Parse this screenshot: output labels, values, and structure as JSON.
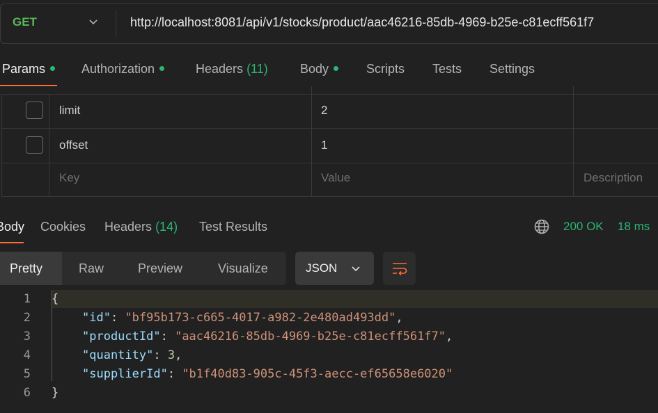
{
  "request": {
    "method": "GET",
    "url": "http://localhost:8081/api/v1/stocks/product/aac46216-85db-4969-b25e-c81ecff561f7"
  },
  "request_tabs": [
    {
      "label": "Params",
      "dot": true,
      "count": ""
    },
    {
      "label": "Authorization",
      "dot": true,
      "count": ""
    },
    {
      "label": "Headers",
      "dot": false,
      "count": "(11)"
    },
    {
      "label": "Body",
      "dot": true,
      "count": ""
    },
    {
      "label": "Scripts",
      "dot": false,
      "count": ""
    },
    {
      "label": "Tests",
      "dot": false,
      "count": ""
    },
    {
      "label": "Settings",
      "dot": false,
      "count": ""
    }
  ],
  "params": {
    "rows": [
      {
        "key": "limit",
        "value": "2",
        "checked": false
      },
      {
        "key": "offset",
        "value": "1",
        "checked": false
      }
    ],
    "placeholder": {
      "key": "Key",
      "value": "Value",
      "description": "Description"
    }
  },
  "response_tabs": [
    {
      "label": "Body",
      "count": ""
    },
    {
      "label": "Cookies",
      "count": ""
    },
    {
      "label": "Headers",
      "count": "(14)"
    },
    {
      "label": "Test Results",
      "count": ""
    }
  ],
  "response_status": {
    "status": "200 OK",
    "time": "18 ms"
  },
  "view_modes": [
    "Pretty",
    "Raw",
    "Preview",
    "Visualize"
  ],
  "format": "JSON",
  "code": {
    "line_numbers": [
      "1",
      "2",
      "3",
      "4",
      "5",
      "6"
    ],
    "open_brace": "{",
    "close_brace": "}",
    "fields": [
      {
        "key": "\"id\"",
        "value": "\"bf95b173-c665-4017-a982-2e480ad493dd\"",
        "type": "string",
        "comma": ","
      },
      {
        "key": "\"productId\"",
        "value": "\"aac46216-85db-4969-b25e-c81ecff561f7\"",
        "type": "string",
        "comma": ","
      },
      {
        "key": "\"quantity\"",
        "value": "3",
        "type": "number",
        "comma": ","
      },
      {
        "key": "\"supplierId\"",
        "value": "\"b1f40d83-905c-45f3-aecc-ef65658e6020\"",
        "type": "string",
        "comma": ""
      }
    ]
  },
  "colors": {
    "accent": "#ff6c37",
    "success": "#2bb673",
    "method_get": "#5cb85c"
  }
}
